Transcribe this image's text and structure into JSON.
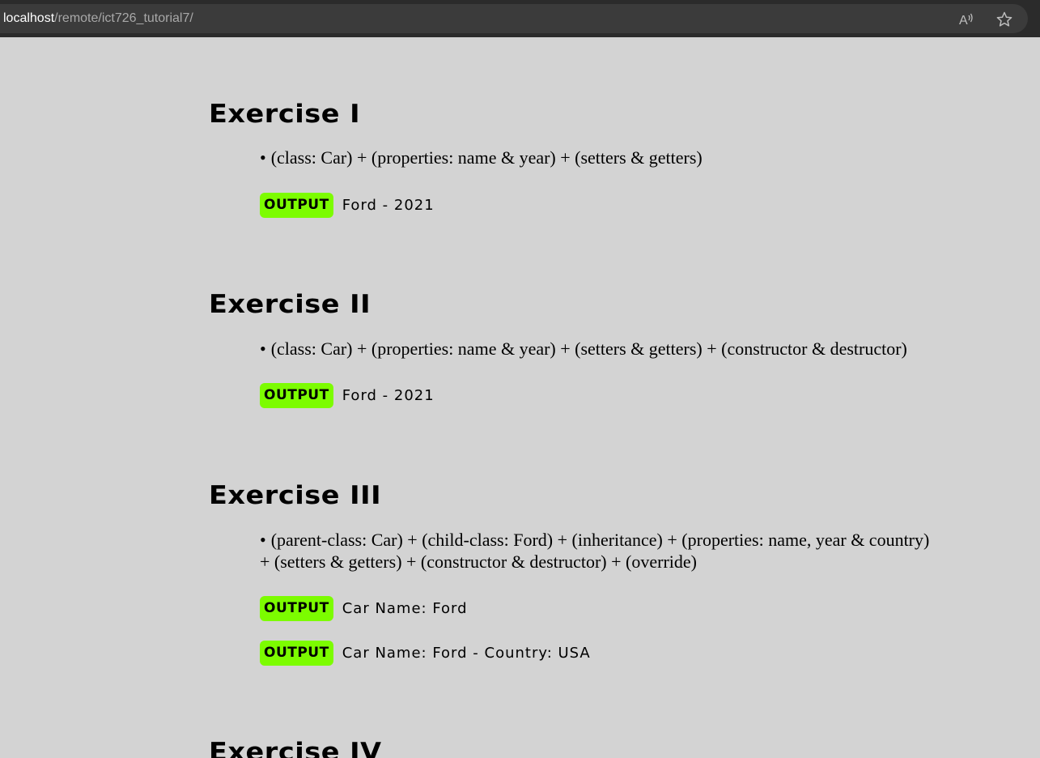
{
  "browser": {
    "url_host": "localhost",
    "url_path": "/remote/ict726_tutorial7/"
  },
  "exercises": [
    {
      "title": "Exercise I",
      "bullet": "•",
      "description": "(class: Car) + (properties: name & year) + (setters & getters)",
      "output_label": "OUTPUT",
      "outputs": [
        "Ford - 2021"
      ]
    },
    {
      "title": "Exercise II",
      "bullet": "•",
      "description": "(class: Car) + (properties: name & year) + (setters & getters) + (constructor & destructor)",
      "output_label": "OUTPUT",
      "outputs": [
        "Ford - 2021"
      ]
    },
    {
      "title": "Exercise III",
      "bullet": "•",
      "description": "(parent-class: Car) + (child-class: Ford) + (inheritance) + (properties: name, year & country) + (setters & getters) + (constructor & destructor) + (override)",
      "output_label": "OUTPUT",
      "outputs": [
        "Car Name: Ford",
        "Car Name: Ford - Country: USA"
      ]
    },
    {
      "title": "Exercise IV"
    }
  ],
  "colors": {
    "background": "#d3d3d3",
    "output_badge": "#7cfc00"
  },
  "icons": [
    "read-aloud-icon",
    "favorite-star-icon"
  ]
}
